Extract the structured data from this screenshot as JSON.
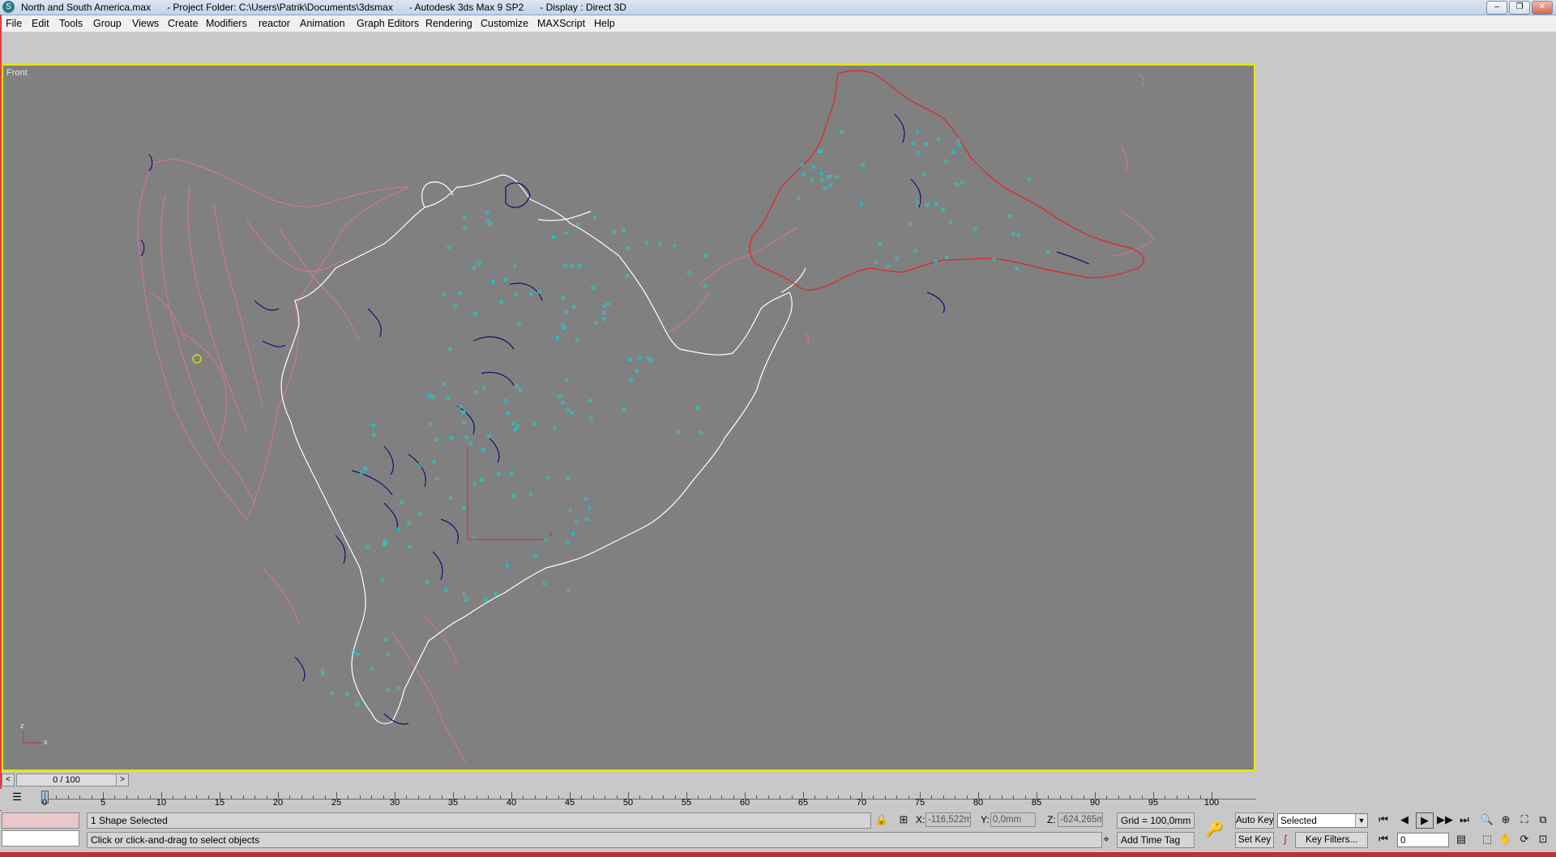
{
  "window": {
    "title": "North and South America.max      - Project Folder: C:\\Users\\Patrik\\Documents\\3dsmax      - Autodesk 3ds Max 9 SP2      - Display : Direct 3D",
    "app_icon": "3ds-max-logo-icon",
    "buttons": {
      "minimize": "‒",
      "maximize": "❐",
      "close": "✕"
    }
  },
  "menu": [
    "File",
    "Edit",
    "Tools",
    "Group",
    "Views",
    "Create",
    "Modifiers",
    "reactor",
    "Animation",
    "Graph Editors",
    "Rendering",
    "Customize",
    "MAXScript",
    "Help"
  ],
  "viewport": {
    "label": "Front",
    "axis_x": "x",
    "axis_z": "z",
    "active_border_color": "#e8e800",
    "background_color": "#808080"
  },
  "time_slider": {
    "value": "0 / 100",
    "prev": "<",
    "next": ">"
  },
  "track_bar": {
    "labels": [
      "0",
      "5",
      "10",
      "15",
      "20",
      "25",
      "30",
      "35",
      "40",
      "45",
      "50",
      "55",
      "60",
      "65",
      "70",
      "75",
      "80",
      "85",
      "90",
      "95",
      "100"
    ],
    "current_frame": 0
  },
  "status": {
    "selection": "1 Shape Selected",
    "prompt": "Click or click-and-drag to select objects",
    "x_label": "X:",
    "x_value": "-116,522mı",
    "y_label": "Y:",
    "y_value": "0,0mm",
    "z_label": "Z:",
    "z_value": "-624,265mı",
    "grid": "Grid = 100,0mm",
    "add_time_tag": "Add Time Tag",
    "auto_key": "Auto Key",
    "set_key": "Set Key",
    "key_mode": "Selected",
    "key_filters": "Key Filters...",
    "frame_value": "0"
  },
  "colors": {
    "north_america_outline": "#ffffff",
    "south_america_outline": "#e82020",
    "pink_contours": "#e070a0",
    "lakes": "#101070",
    "cities": "#20d0d0"
  }
}
